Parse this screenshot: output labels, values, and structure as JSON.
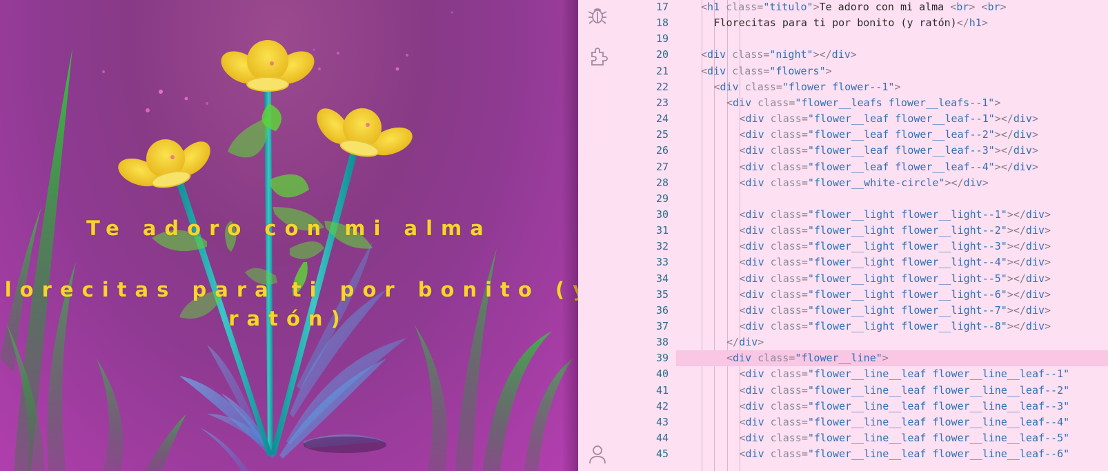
{
  "preview": {
    "title_line1": "Te adoro con mi alma",
    "title_line2": "Florecitas para ti por bonito (y ratón)"
  },
  "activity_bar": {
    "icons": [
      "debug-icon",
      "extensions-icon",
      "account-icon"
    ]
  },
  "editor": {
    "lines": [
      {
        "n": "17",
        "indent": 2,
        "code": "<h1 class=\"titulo\">Te adoro con mi alma <br> <br>"
      },
      {
        "n": "18",
        "indent": 3,
        "code": "Florecitas para ti por bonito (y ratón)</h1>"
      },
      {
        "n": "19",
        "indent": 2,
        "code": ""
      },
      {
        "n": "20",
        "indent": 2,
        "code": "<div class=\"night\"></div>"
      },
      {
        "n": "21",
        "indent": 2,
        "code": "<div class=\"flowers\">"
      },
      {
        "n": "22",
        "indent": 3,
        "code": "<div class=\"flower flower--1\">"
      },
      {
        "n": "23",
        "indent": 4,
        "code": "<div class=\"flower__leafs flower__leafs--1\">"
      },
      {
        "n": "24",
        "indent": 5,
        "code": "<div class=\"flower__leaf flower__leaf--1\"></div>"
      },
      {
        "n": "25",
        "indent": 5,
        "code": "<div class=\"flower__leaf flower__leaf--2\"></div>"
      },
      {
        "n": "26",
        "indent": 5,
        "code": "<div class=\"flower__leaf flower__leaf--3\"></div>"
      },
      {
        "n": "27",
        "indent": 5,
        "code": "<div class=\"flower__leaf flower__leaf--4\"></div>"
      },
      {
        "n": "28",
        "indent": 5,
        "code": "<div class=\"flower__white-circle\"></div>"
      },
      {
        "n": "29",
        "indent": 5,
        "code": ""
      },
      {
        "n": "30",
        "indent": 5,
        "code": "<div class=\"flower__light flower__light--1\"></div>"
      },
      {
        "n": "31",
        "indent": 5,
        "code": "<div class=\"flower__light flower__light--2\"></div>"
      },
      {
        "n": "32",
        "indent": 5,
        "code": "<div class=\"flower__light flower__light--3\"></div>"
      },
      {
        "n": "33",
        "indent": 5,
        "code": "<div class=\"flower__light flower__light--4\"></div>"
      },
      {
        "n": "34",
        "indent": 5,
        "code": "<div class=\"flower__light flower__light--5\"></div>"
      },
      {
        "n": "35",
        "indent": 5,
        "code": "<div class=\"flower__light flower__light--6\"></div>"
      },
      {
        "n": "36",
        "indent": 5,
        "code": "<div class=\"flower__light flower__light--7\"></div>"
      },
      {
        "n": "37",
        "indent": 5,
        "code": "<div class=\"flower__light flower__light--8\"></div>"
      },
      {
        "n": "38",
        "indent": 4,
        "code": "</div>"
      },
      {
        "n": "39",
        "indent": 4,
        "code": "<div class=\"flower__line\">",
        "active": true
      },
      {
        "n": "40",
        "indent": 5,
        "code": "<div class=\"flower__line__leaf flower__line__leaf--1\""
      },
      {
        "n": "41",
        "indent": 5,
        "code": "<div class=\"flower__line__leaf flower__line__leaf--2\""
      },
      {
        "n": "42",
        "indent": 5,
        "code": "<div class=\"flower__line__leaf flower__line__leaf--3\""
      },
      {
        "n": "43",
        "indent": 5,
        "code": "<div class=\"flower__line__leaf flower__line__leaf--4\""
      },
      {
        "n": "44",
        "indent": 5,
        "code": "<div class=\"flower__line__leaf flower__line__leaf--5\""
      },
      {
        "n": "45",
        "indent": 5,
        "code": "<div class=\"flower__line__leaf flower__line__leaf--6\""
      }
    ]
  },
  "colors": {
    "petal": "#f6d52c",
    "stem": "#1aa6a8",
    "leaf": "#5fd13a",
    "grass": "#2aa83a",
    "editor_bg": "#fde0f2",
    "tag": "#2f71b5"
  }
}
